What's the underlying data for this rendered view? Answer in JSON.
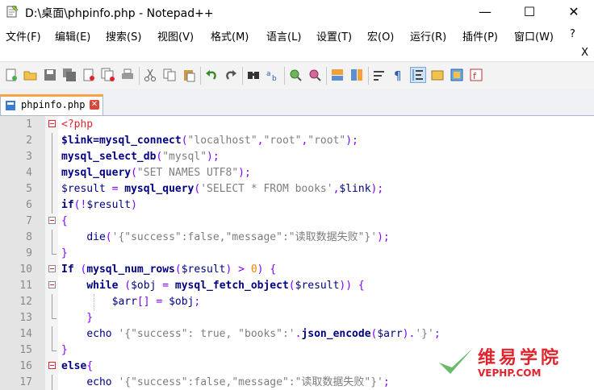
{
  "window": {
    "title": "D:\\桌面\\phpinfo.php - Notepad++",
    "minimize": "—",
    "maximize": "☐",
    "close": "✕"
  },
  "menu": {
    "items": [
      "文件(F)",
      "编辑(E)",
      "搜索(S)",
      "视图(V)",
      "格式(M)",
      "语言(L)",
      "设置(T)",
      "宏(O)",
      "运行(R)",
      "插件(P)",
      "窗口(W)",
      "?"
    ],
    "close_doc": "X"
  },
  "toolbar": {
    "buttons": [
      "new-file-icon",
      "open-file-icon",
      "save-icon",
      "save-all-icon",
      "close-icon",
      "close-all-icon",
      "print-icon",
      "cut-icon",
      "copy-icon",
      "paste-icon",
      "undo-icon",
      "redo-icon",
      "find-icon",
      "replace-icon",
      "zoom-in-icon",
      "zoom-out-icon",
      "sync-vertical-icon",
      "sync-horizontal-icon",
      "word-wrap-icon",
      "show-all-chars-icon",
      "indent-guide-icon",
      "user-lang-icon",
      "doc-map-icon",
      "function-list-icon"
    ]
  },
  "tab": {
    "label": "phpinfo.php",
    "close": "✕"
  },
  "editor": {
    "lines": [
      {
        "n": "1",
        "text": "<?php"
      },
      {
        "n": "2",
        "text": "$link=mysql_connect(\"localhost\",\"root\",\"root\");"
      },
      {
        "n": "3",
        "text": "mysql_select_db(\"mysql\");"
      },
      {
        "n": "4",
        "text": "mysql_query(\"SET NAMES UTF8\");"
      },
      {
        "n": "5",
        "text": "$result = mysql_query('SELECT * FROM books',$link);"
      },
      {
        "n": "6",
        "text": "if(!$result)"
      },
      {
        "n": "7",
        "text": "{"
      },
      {
        "n": "8",
        "text": "    die('{\"success\":false,\"message\":\"读取数据失败\"}');"
      },
      {
        "n": "9",
        "text": "}"
      },
      {
        "n": "10",
        "text": "If (mysql_num_rows($result) > 0) {"
      },
      {
        "n": "11",
        "text": "    while ($obj = mysql_fetch_object($result)) {"
      },
      {
        "n": "12",
        "text": "        $arr[] = $obj;"
      },
      {
        "n": "13",
        "text": "    }"
      },
      {
        "n": "14",
        "text": "    echo '{\"success\": true, \"books\":'.json_encode($arr).'}';"
      },
      {
        "n": "15",
        "text": "}"
      },
      {
        "n": "16",
        "text": "else{"
      },
      {
        "n": "17",
        "text": "    echo '{\"success\":false,\"message\":\"读取数据失败\"}';"
      }
    ]
  },
  "watermark": {
    "text": "维易学院",
    "sub": "VEPHP.COM"
  }
}
